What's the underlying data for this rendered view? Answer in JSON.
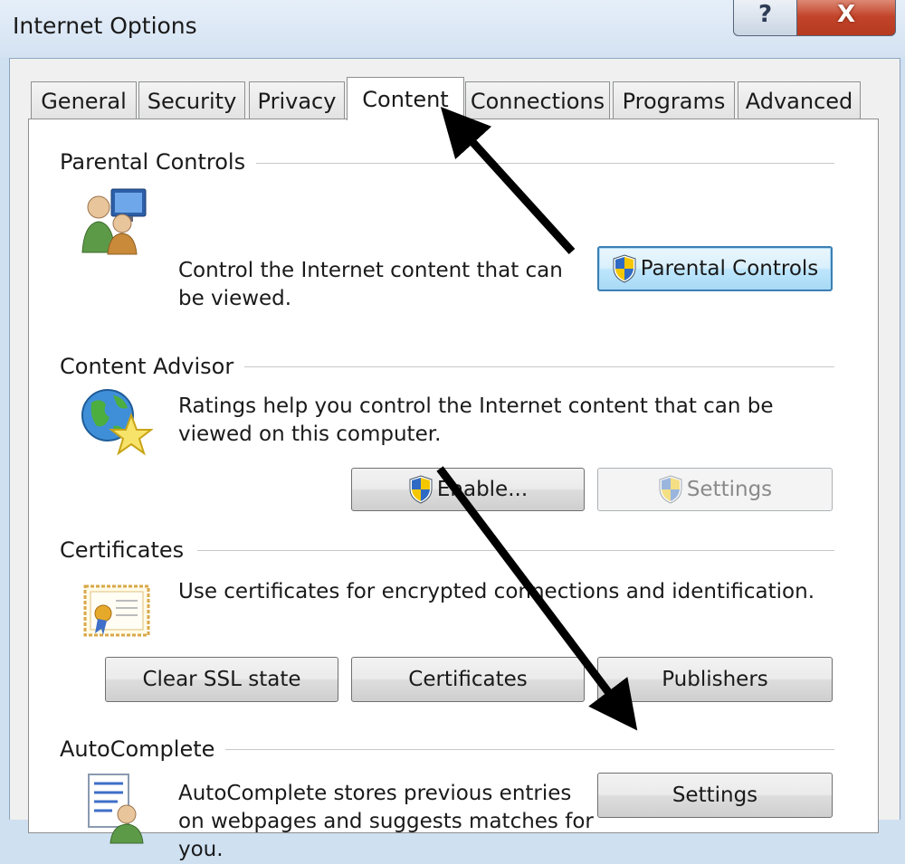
{
  "window": {
    "title": "Internet Options",
    "help_label": "?",
    "close_label": "X"
  },
  "tabs": [
    {
      "label": "General"
    },
    {
      "label": "Security"
    },
    {
      "label": "Privacy"
    },
    {
      "label": "Content",
      "active": true
    },
    {
      "label": "Connections"
    },
    {
      "label": "Programs"
    },
    {
      "label": "Advanced"
    }
  ],
  "parental_controls": {
    "title": "Parental Controls",
    "description": "Control the Internet content that can be viewed.",
    "button_label": "Parental Controls",
    "icon": "parental-controls-icon"
  },
  "content_advisor": {
    "title": "Content Advisor",
    "description": "Ratings help you control the Internet content that can be viewed on this computer.",
    "enable_label": "Enable...",
    "settings_label": "Settings",
    "icon": "globe-star-icon"
  },
  "certificates": {
    "title": "Certificates",
    "description": "Use certificates for encrypted connections and identification.",
    "clear_ssl_label": "Clear SSL state",
    "certificates_label": "Certificates",
    "publishers_label": "Publishers",
    "icon": "certificate-icon"
  },
  "autocomplete": {
    "title": "AutoComplete",
    "description": "AutoComplete stores previous entries on webpages and suggests matches for you.",
    "settings_label": "Settings",
    "icon": "autocomplete-form-icon"
  },
  "colors": {
    "accent_border": "#3c7fb1",
    "close_red": "#c2442a",
    "annotation_arrow": "#000000"
  }
}
